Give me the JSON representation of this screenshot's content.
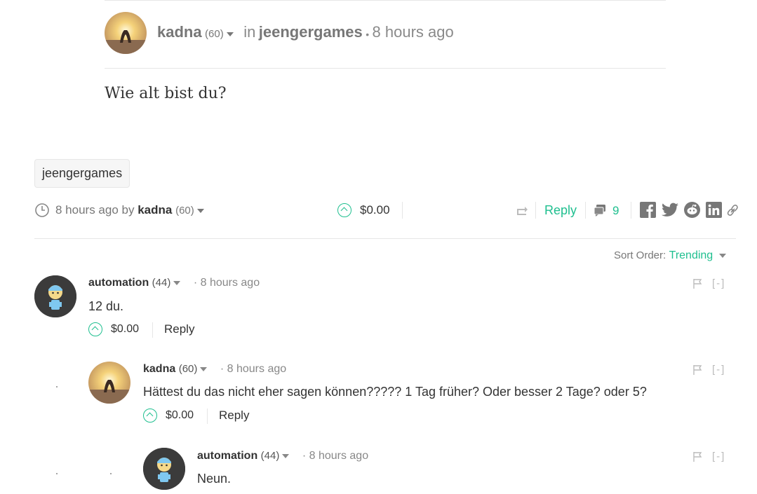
{
  "post": {
    "author": "kadna",
    "reputation": "(60)",
    "in_label": "in",
    "category": "jeengergames",
    "separator": "•",
    "time": "8 hours ago",
    "body": "Wie alt bist du?",
    "tag": "jeengergames",
    "footer_time": "8 hours ago by",
    "footer_author": "kadna",
    "footer_rep": "(60)",
    "payout": "$0.00",
    "reply_label": "Reply",
    "comment_count": "9"
  },
  "sort": {
    "label": "Sort Order:",
    "value": "Trending"
  },
  "comments": [
    {
      "author": "automation",
      "rep": "(44)",
      "bullet": "·",
      "time": "8 hours ago",
      "body": "12 du.",
      "payout": "$0.00",
      "reply": "Reply",
      "collapse": "[-]"
    },
    {
      "author": "kadna",
      "rep": "(60)",
      "bullet": "·",
      "time": "8 hours ago",
      "body": "Hättest du das nicht eher sagen können????? 1 Tag früher? Oder besser 2 Tage? oder 5?",
      "payout": "$0.00",
      "reply": "Reply",
      "collapse": "[-]"
    },
    {
      "author": "automation",
      "rep": "(44)",
      "bullet": "·",
      "time": "8 hours ago",
      "body": "Neun.",
      "collapse": "[-]"
    }
  ],
  "colors": {
    "accent": "#1fbf8f",
    "muted": "#777777",
    "rule": "#e6e6e6"
  },
  "icons": [
    "clock-icon",
    "upvote-icon",
    "resteem-icon",
    "comments-icon",
    "facebook-icon",
    "twitter-icon",
    "reddit-icon",
    "linkedin-icon",
    "link-icon",
    "flag-icon",
    "caret-down-icon"
  ]
}
